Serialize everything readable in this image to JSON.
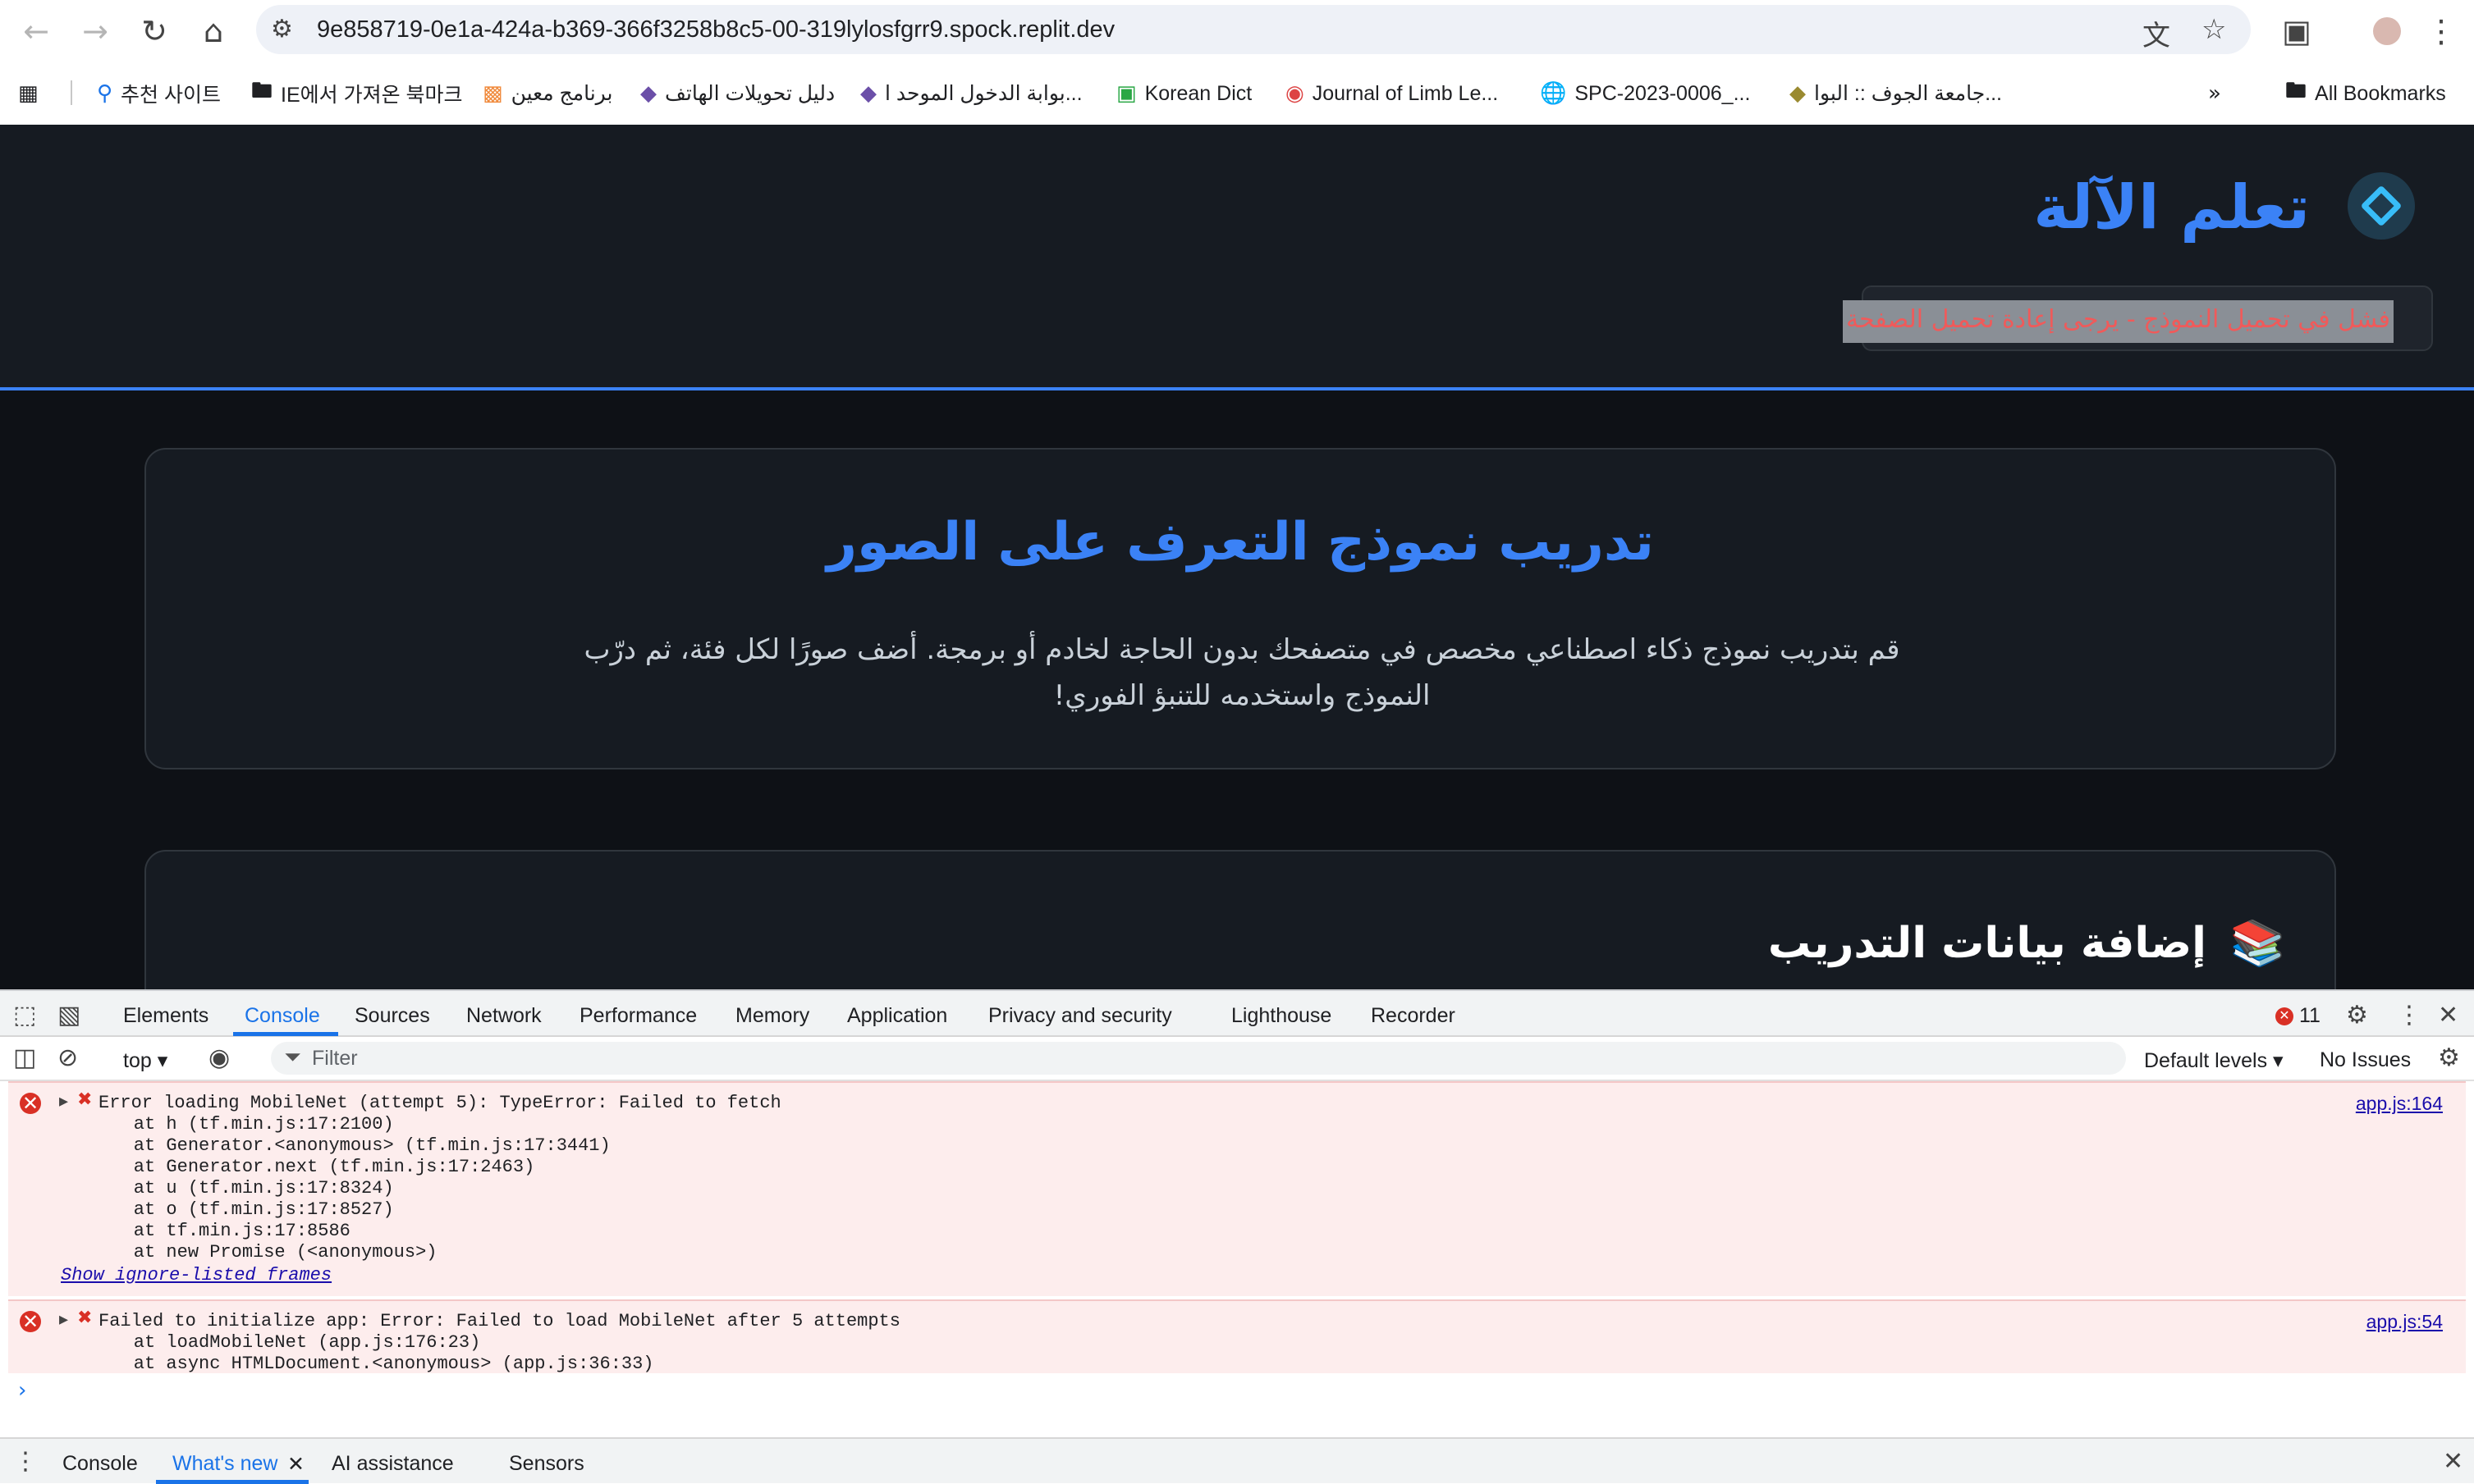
{
  "browser": {
    "url": "9e858719-0e1a-424a-b369-366f3258b8c5-00-319lylosfgrr9.spock.replit.dev",
    "bookmarks": [
      {
        "label": "추천 사이트",
        "icon": "search-icon"
      },
      {
        "label": "IE에서 가져온 북마크",
        "icon": "folder-icon"
      },
      {
        "label": "برنامج معين",
        "icon": "app-icon"
      },
      {
        "label": "دليل تحويلات الهاتف",
        "icon": "site-icon"
      },
      {
        "label": "بوابة الدخول الموحد ا...",
        "icon": "site-icon"
      },
      {
        "label": "Korean Dict",
        "icon": "dict-icon"
      },
      {
        "label": "Journal of Limb Le...",
        "icon": "journal-icon"
      },
      {
        "label": "SPC-2023-0006_...",
        "icon": "globe-icon"
      },
      {
        "label": "جامعة الجوف :: البوا...",
        "icon": "site-icon"
      }
    ],
    "all_bookmarks_label": "All Bookmarks"
  },
  "app": {
    "brand_title": "تعلم الآلة",
    "status_text": "فشل في تحميل النموذج - يرجى إعادة تحميل الصفحة",
    "hero": {
      "title": "تدريب نموذج التعرف على الصور",
      "description": "قم بتدريب نموذج ذكاء اصطناعي مخصص في متصفحك بدون الحاجة لخادم أو برمجة. أضف صورًا لكل فئة، ثم درّب النموذج واستخدمه للتنبؤ الفوري!"
    },
    "training": {
      "title": "إضافة بيانات التدريب",
      "icon": "books-icon"
    }
  },
  "devtools": {
    "tabs": [
      "Elements",
      "Console",
      "Sources",
      "Network",
      "Performance",
      "Memory",
      "Application",
      "Privacy and security",
      "Lighthouse",
      "Recorder"
    ],
    "active_tab": "Console",
    "error_count": "11",
    "context": "top",
    "filter_placeholder": "Filter",
    "levels": "Default levels",
    "issues": "No Issues",
    "messages": [
      {
        "source": "app.js:164",
        "lines": [
          "Error loading MobileNet (attempt 5): TypeError: Failed to fetch",
          "    at h (tf.min.js:17:2100)",
          "    at Generator.<anonymous> (tf.min.js:17:3441)",
          "    at Generator.next (tf.min.js:17:2463)",
          "    at u (tf.min.js:17:8324)",
          "    at o (tf.min.js:17:8527)",
          "    at tf.min.js:17:8586",
          "    at new Promise (<anonymous>)"
        ],
        "footer": "Show ignore-listed frames"
      },
      {
        "source": "app.js:54",
        "lines": [
          "Failed to initialize app: Error: Failed to load MobileNet after 5 attempts",
          "    at loadMobileNet (app.js:176:23)",
          "    at async HTMLDocument.<anonymous> (app.js:36:33)"
        ]
      }
    ],
    "drawer_tabs": [
      "Console",
      "What's new",
      "AI assistance",
      "Sensors"
    ],
    "drawer_active": "What's new"
  }
}
